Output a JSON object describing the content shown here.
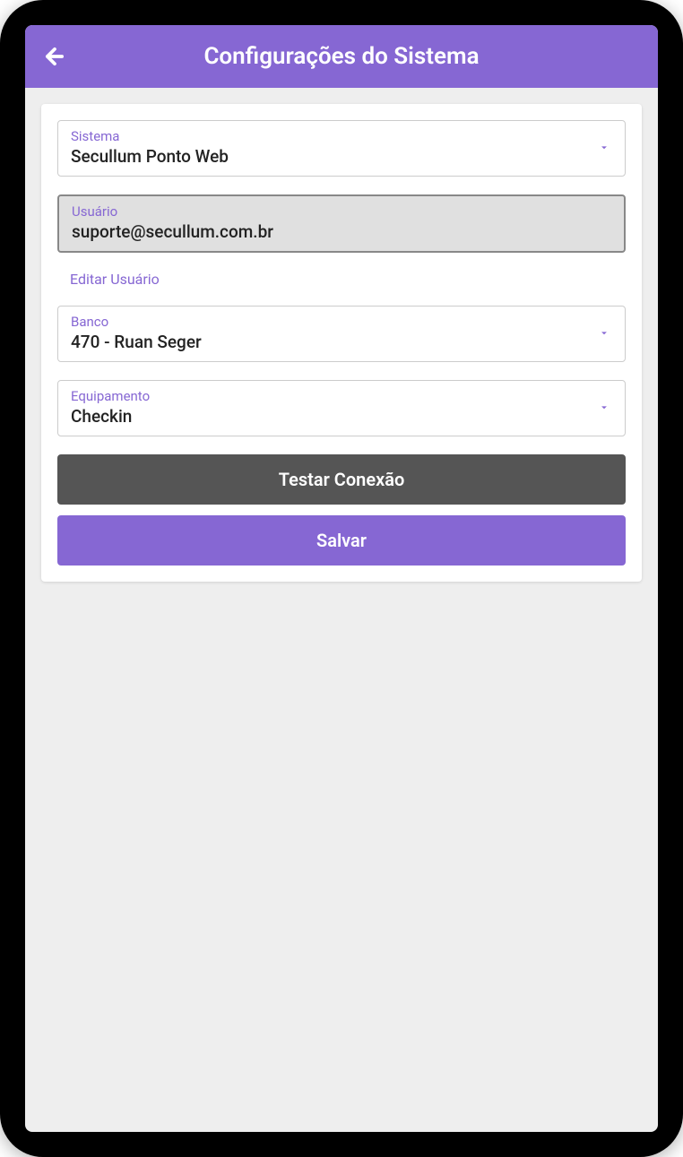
{
  "header": {
    "title": "Configurações do Sistema"
  },
  "fields": {
    "sistema": {
      "label": "Sistema",
      "value": "Secullum Ponto Web"
    },
    "usuario": {
      "label": "Usuário",
      "value": "suporte@secullum.com.br"
    },
    "editarUsuarioLink": "Editar Usuário",
    "banco": {
      "label": "Banco",
      "value": "470 - Ruan Seger"
    },
    "equipamento": {
      "label": "Equipamento",
      "value": "Checkin"
    }
  },
  "buttons": {
    "testarConexao": "Testar Conexão",
    "salvar": "Salvar"
  },
  "colors": {
    "primary": "#8667d3",
    "dark": "#555555"
  }
}
